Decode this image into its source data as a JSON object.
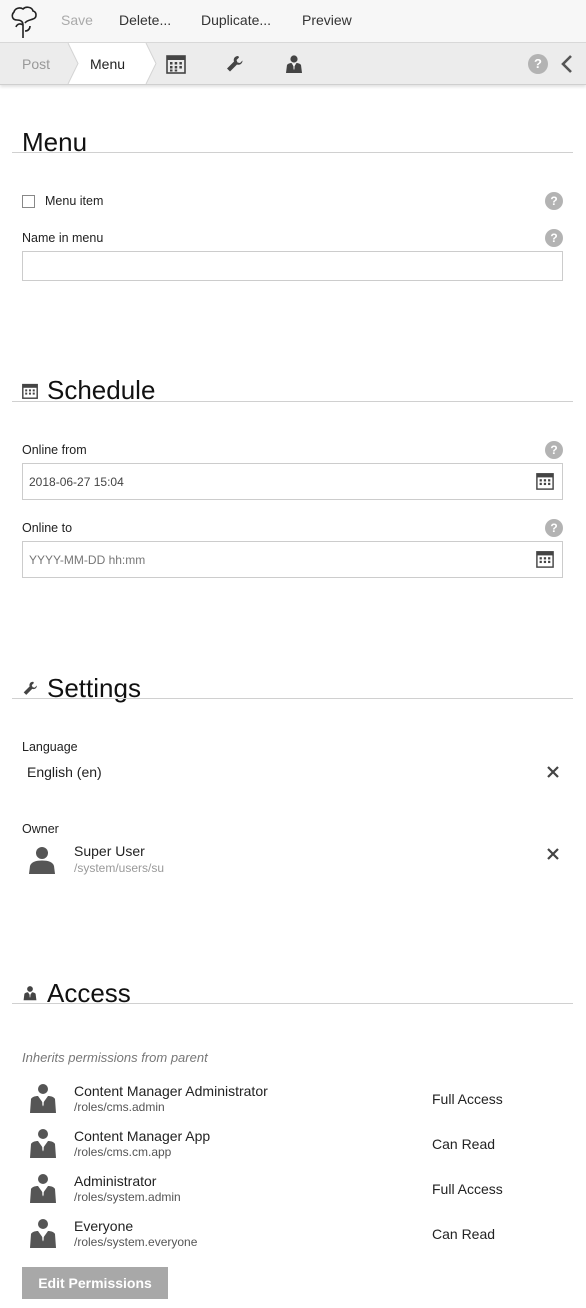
{
  "toolbar": {
    "save": "Save",
    "delete": "Delete...",
    "duplicate": "Duplicate...",
    "preview": "Preview"
  },
  "tabs": {
    "post": "Post",
    "menu": "Menu",
    "icons": [
      "calendar-icon",
      "wrench-icon",
      "user-icon"
    ],
    "help": "?"
  },
  "menu_section": {
    "title": "Menu",
    "menu_item_label": "Menu item",
    "name_in_menu_label": "Name in menu",
    "name_in_menu_value": ""
  },
  "schedule_section": {
    "title": "Schedule",
    "online_from_label": "Online from",
    "online_from_value": "2018-06-27 15:04",
    "online_to_label": "Online to",
    "online_to_placeholder": "YYYY-MM-DD hh:mm"
  },
  "settings_section": {
    "title": "Settings",
    "language_label": "Language",
    "language_value": "English (en)",
    "owner_label": "Owner",
    "owner_name": "Super User",
    "owner_path": "/system/users/su"
  },
  "access_section": {
    "title": "Access",
    "inherits_note": "Inherits permissions from parent",
    "roles": [
      {
        "name": "Content Manager Administrator",
        "path": "/roles/cms.admin",
        "access": "Full Access"
      },
      {
        "name": "Content Manager App",
        "path": "/roles/cms.cm.app",
        "access": "Can Read"
      },
      {
        "name": "Administrator",
        "path": "/roles/system.admin",
        "access": "Full Access"
      },
      {
        "name": "Everyone",
        "path": "/roles/system.everyone",
        "access": "Can Read"
      }
    ],
    "edit_button": "Edit Permissions"
  }
}
